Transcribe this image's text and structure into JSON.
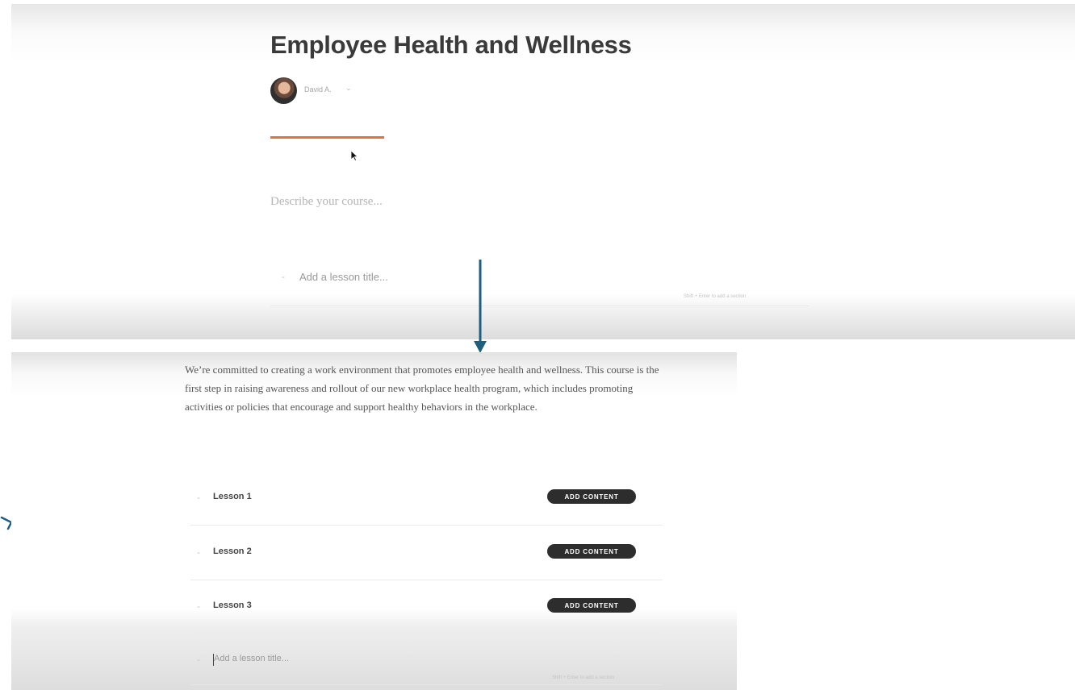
{
  "top_screen": {
    "course_title": "Employee Health and Wellness",
    "author": {
      "name": "David A.",
      "chevron_icon": "chevron-down-icon"
    },
    "description_placeholder": "Describe your course...",
    "new_lesson_placeholder": "Add a lesson title...",
    "new_lesson_hint": "Shift + Enter to add a section",
    "accent_color": "#e2703a"
  },
  "bottom_screen": {
    "description": "We’re committed to creating a work environment that promotes employee health and wellness. This course is the first step in raising awareness and rollout of our new workplace health program, which includes promoting activities or policies that encourage and support healthy behaviors in the workplace.",
    "lessons": [
      {
        "title": "Lesson 1",
        "button_label": "ADD CONTENT"
      },
      {
        "title": "Lesson 2",
        "button_label": "ADD CONTENT"
      },
      {
        "title": "Lesson 3",
        "button_label": "ADD CONTENT"
      }
    ],
    "new_lesson_placeholder": "Add a lesson title...",
    "new_lesson_hint": "Shift + Enter to add a section"
  },
  "arrow_color": "#1e5f80"
}
